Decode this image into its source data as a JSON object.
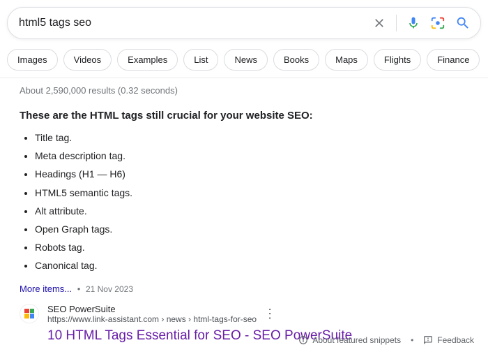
{
  "search": {
    "query": "html5 tags seo"
  },
  "chips": {
    "items": [
      "Images",
      "Videos",
      "Examples",
      "List",
      "News",
      "Books",
      "Maps",
      "Flights",
      "Finance"
    ]
  },
  "stats": "About 2,590,000 results (0.32 seconds)",
  "snippet": {
    "heading": "These are the HTML tags still crucial for your website SEO:",
    "items": [
      "Title tag.",
      "Meta description tag.",
      "Headings (H1 — H6)",
      "HTML5 semantic tags.",
      "Alt attribute.",
      "Open Graph tags.",
      "Robots tag.",
      "Canonical tag."
    ],
    "more": "More items...",
    "date": "21 Nov 2023"
  },
  "result": {
    "site_name": "SEO PowerSuite",
    "url_display": "https://www.link-assistant.com › news › html-tags-for-seo",
    "title": "10 HTML Tags Essential for SEO - SEO PowerSuite"
  },
  "footer": {
    "about": "About featured snippets",
    "feedback": "Feedback"
  }
}
